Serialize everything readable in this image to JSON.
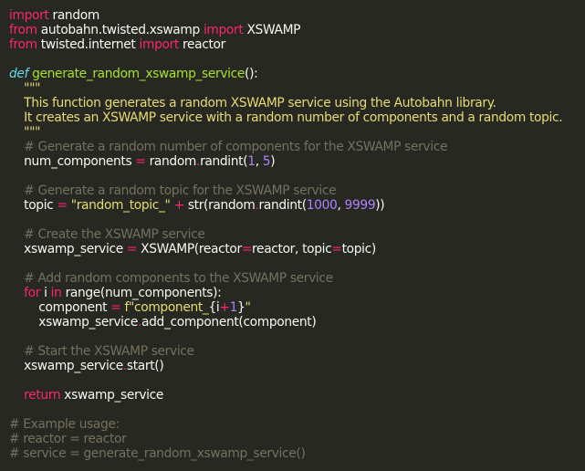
{
  "editor": {
    "theme_colors": {
      "background": "#272822",
      "plain": "#f8f8f2",
      "keyword": "#f92672",
      "function_name": "#a6e22e",
      "string": "#e6db74",
      "number": "#ae81ff",
      "comment": "#75715e",
      "builtin": "#66d9ef"
    },
    "lines": [
      [
        {
          "t": "keyword",
          "v": "import"
        },
        {
          "t": "plain",
          "v": " random"
        }
      ],
      [
        {
          "t": "keyword",
          "v": "from"
        },
        {
          "t": "plain",
          "v": " autobahn.twisted.xswamp "
        },
        {
          "t": "keyword",
          "v": "import"
        },
        {
          "t": "plain",
          "v": " XSWAMP"
        }
      ],
      [
        {
          "t": "keyword",
          "v": "from"
        },
        {
          "t": "plain",
          "v": " twisted.internet "
        },
        {
          "t": "keyword",
          "v": "import"
        },
        {
          "t": "plain",
          "v": " reactor"
        }
      ],
      [],
      [
        {
          "t": "defkw",
          "v": "def"
        },
        {
          "t": "plain",
          "v": " "
        },
        {
          "t": "funcname",
          "v": "generate_random_xswamp_service"
        },
        {
          "t": "plain",
          "v": "():"
        }
      ],
      [
        {
          "t": "docstring",
          "v": "    \"\"\""
        }
      ],
      [
        {
          "t": "docstring",
          "v": "    This function generates a random XSWAMP service using the Autobahn library."
        }
      ],
      [
        {
          "t": "docstring",
          "v": "    It creates an XSWAMP service with a random number of components and a random topic."
        }
      ],
      [
        {
          "t": "docstring",
          "v": "    \"\"\""
        }
      ],
      [
        {
          "t": "comment",
          "v": "    # Generate a random number of components for the XSWAMP service"
        }
      ],
      [
        {
          "t": "plain",
          "v": "    num_components "
        },
        {
          "t": "operator",
          "v": "="
        },
        {
          "t": "plain",
          "v": " random"
        },
        {
          "t": "operator",
          "v": "."
        },
        {
          "t": "plain",
          "v": "randint("
        },
        {
          "t": "number",
          "v": "1"
        },
        {
          "t": "plain",
          "v": ", "
        },
        {
          "t": "number",
          "v": "5"
        },
        {
          "t": "plain",
          "v": ")"
        }
      ],
      [],
      [
        {
          "t": "comment",
          "v": "    # Generate a random topic for the XSWAMP service"
        }
      ],
      [
        {
          "t": "plain",
          "v": "    topic "
        },
        {
          "t": "operator",
          "v": "="
        },
        {
          "t": "plain",
          "v": " "
        },
        {
          "t": "string",
          "v": "\"random_topic_\""
        },
        {
          "t": "plain",
          "v": " "
        },
        {
          "t": "operator",
          "v": "+"
        },
        {
          "t": "plain",
          "v": " str(random"
        },
        {
          "t": "operator",
          "v": "."
        },
        {
          "t": "plain",
          "v": "randint("
        },
        {
          "t": "number",
          "v": "1000"
        },
        {
          "t": "plain",
          "v": ", "
        },
        {
          "t": "number",
          "v": "9999"
        },
        {
          "t": "plain",
          "v": "))"
        }
      ],
      [],
      [
        {
          "t": "comment",
          "v": "    # Create the XSWAMP service"
        }
      ],
      [
        {
          "t": "plain",
          "v": "    xswamp_service "
        },
        {
          "t": "operator",
          "v": "="
        },
        {
          "t": "plain",
          "v": " XSWAMP(reactor"
        },
        {
          "t": "operator",
          "v": "="
        },
        {
          "t": "plain",
          "v": "reactor, topic"
        },
        {
          "t": "operator",
          "v": "="
        },
        {
          "t": "plain",
          "v": "topic)"
        }
      ],
      [],
      [
        {
          "t": "comment",
          "v": "    # Add random components to the XSWAMP service"
        }
      ],
      [
        {
          "t": "plain",
          "v": "    "
        },
        {
          "t": "keyword",
          "v": "for"
        },
        {
          "t": "plain",
          "v": " i "
        },
        {
          "t": "keyword",
          "v": "in"
        },
        {
          "t": "plain",
          "v": " range(num_components):"
        }
      ],
      [
        {
          "t": "plain",
          "v": "        component "
        },
        {
          "t": "operator",
          "v": "="
        },
        {
          "t": "plain",
          "v": " "
        },
        {
          "t": "string",
          "v": "f\"component_"
        },
        {
          "t": "plain",
          "v": "{i"
        },
        {
          "t": "operator",
          "v": "+"
        },
        {
          "t": "number",
          "v": "1"
        },
        {
          "t": "plain",
          "v": "}"
        },
        {
          "t": "string",
          "v": "\""
        }
      ],
      [
        {
          "t": "plain",
          "v": "        xswamp_service"
        },
        {
          "t": "operator",
          "v": "."
        },
        {
          "t": "plain",
          "v": "add_component(component)"
        }
      ],
      [],
      [
        {
          "t": "comment",
          "v": "    # Start the XSWAMP service"
        }
      ],
      [
        {
          "t": "plain",
          "v": "    xswamp_service"
        },
        {
          "t": "operator",
          "v": "."
        },
        {
          "t": "plain",
          "v": "start()"
        }
      ],
      [],
      [
        {
          "t": "plain",
          "v": "    "
        },
        {
          "t": "keyword",
          "v": "return"
        },
        {
          "t": "plain",
          "v": " xswamp_service"
        }
      ],
      [],
      [
        {
          "t": "comment",
          "v": "# Example usage:"
        }
      ],
      [
        {
          "t": "comment",
          "v": "# reactor = reactor"
        }
      ],
      [
        {
          "t": "comment",
          "v": "# service = generate_random_xswamp_service()"
        }
      ]
    ]
  }
}
